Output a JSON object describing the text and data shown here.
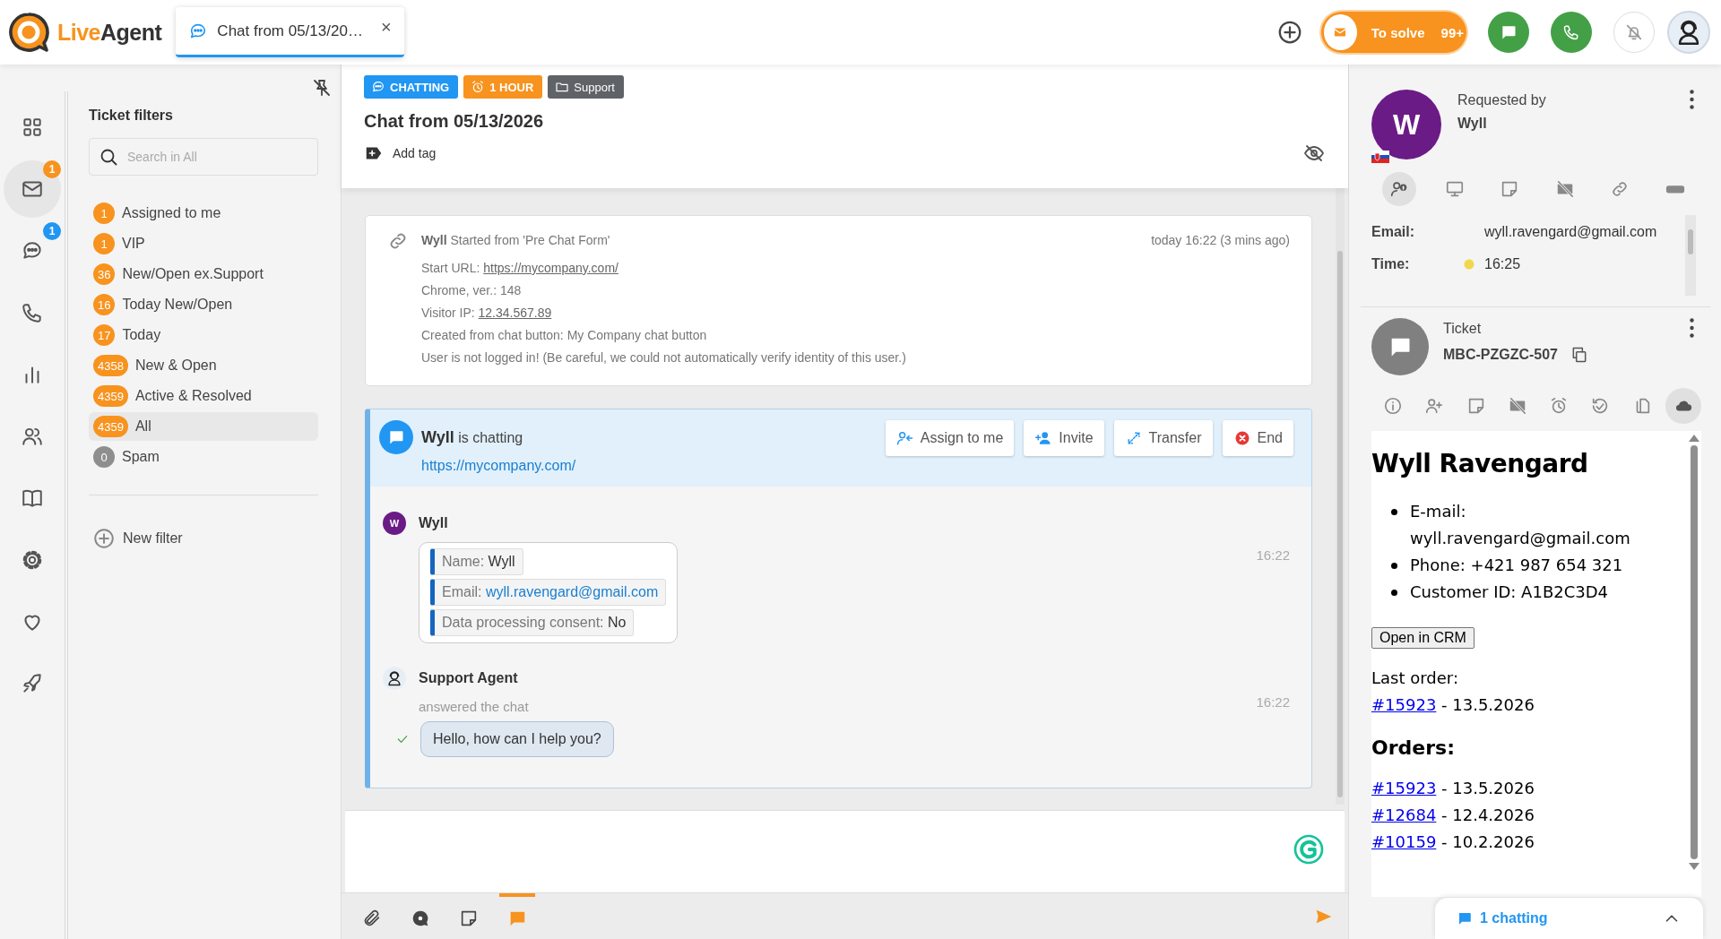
{
  "app": {
    "logo_primary": "Live",
    "logo_secondary": "Agent"
  },
  "top_tabs": [
    {
      "label": "Chat from 05/13/20…",
      "close": "×",
      "selected": true
    }
  ],
  "to_solve": {
    "label": "To solve",
    "count": "99+"
  },
  "nav": [
    {
      "kind": "dashboard",
      "selected": false
    },
    {
      "kind": "tickets",
      "selected": true,
      "badge": {
        "text": "1",
        "color": "#f7931e"
      }
    },
    {
      "kind": "chats",
      "selected": false,
      "badge": {
        "text": "1",
        "color": "#2196f3"
      }
    },
    {
      "kind": "calls",
      "selected": false
    },
    {
      "kind": "reports",
      "selected": false
    },
    {
      "kind": "customers",
      "selected": false
    },
    {
      "kind": "knowledgebase",
      "selected": false
    },
    {
      "kind": "settings",
      "selected": false
    },
    {
      "kind": "plugins",
      "selected": false
    },
    {
      "kind": "getting_started",
      "selected": false
    }
  ],
  "filters": {
    "title": "Ticket filters",
    "search": {
      "placeholder": "Search in All"
    },
    "items": [
      {
        "count": "1",
        "label": "Assigned to me",
        "color": "#f7931e",
        "selected": false
      },
      {
        "count": "1",
        "label": "VIP",
        "color": "#f7931e",
        "selected": false
      },
      {
        "count": "36",
        "label": "New/Open ex.Support",
        "color": "#f7931e",
        "selected": false
      },
      {
        "count": "16",
        "label": "Today New/Open",
        "color": "#f7931e",
        "selected": false
      },
      {
        "count": "17",
        "label": "Today",
        "color": "#f7931e",
        "selected": false
      },
      {
        "count": "4358",
        "label": "New & Open",
        "color": "#f7931e",
        "selected": false
      },
      {
        "count": "4359",
        "label": "Active & Resolved",
        "color": "#f7931e",
        "selected": false
      },
      {
        "count": "4359",
        "label": "All",
        "color": "#f7931e",
        "selected": true
      },
      {
        "count": "0",
        "label": "Spam",
        "color": "#8e8e8e",
        "selected": false
      }
    ],
    "new_filter": "New filter"
  },
  "ticket": {
    "tags": [
      {
        "kind": "status",
        "label": "CHATTING",
        "color": "#2196f3"
      },
      {
        "kind": "sla",
        "label": "1 HOUR",
        "color": "#f7931e"
      },
      {
        "kind": "department",
        "label": "Support",
        "color": "#5f6368"
      }
    ],
    "title": "Chat from 05/13/2026",
    "add_tag": "Add tag"
  },
  "info_card": {
    "name": "Wyll",
    "source": "Started from 'Pre Chat Form'",
    "time": "today 16:22 (3 mins ago)",
    "lines": [
      {
        "text": "Start URL:",
        "link": "https://mycompany.com/"
      },
      {
        "text": "Chrome, ver.: 148"
      },
      {
        "text": "Visitor IP:",
        "link": "12.34.567.89"
      },
      {
        "text": "Created from chat button: My Company chat button"
      },
      {
        "text": "User is not logged in! (Be careful, we could not automatically verify identity of this user.)"
      }
    ]
  },
  "chat": {
    "visitor": "Wyll",
    "status": "is chatting",
    "url": "https://mycompany.com/",
    "actions": [
      {
        "kind": "assign",
        "label": "Assign to me"
      },
      {
        "kind": "invite",
        "label": "Invite"
      },
      {
        "kind": "transfer",
        "label": "Transfer"
      },
      {
        "kind": "end",
        "label": "End"
      }
    ],
    "messages": [
      {
        "kind": "form",
        "author": "Wyll",
        "initial": "W",
        "time": "16:22",
        "fields": [
          {
            "label": "Name:",
            "value": "Wyll",
            "link": false
          },
          {
            "label": "Email:",
            "value": "wyll.ravengard@gmail.com",
            "link": true
          },
          {
            "label": "Data processing consent:",
            "value": "No",
            "link": false
          }
        ]
      },
      {
        "kind": "agent",
        "author": "Support Agent",
        "note": "answered the chat",
        "time": "16:22",
        "text": "Hello, how can I help you?",
        "delivered": true
      }
    ]
  },
  "composer": {
    "tools": [
      {
        "kind": "attach",
        "selected": false
      },
      {
        "kind": "canned",
        "selected": false
      },
      {
        "kind": "note",
        "selected": false
      },
      {
        "kind": "chat",
        "selected": true
      }
    ]
  },
  "contact": {
    "label": "Requested by",
    "name": "Wyll",
    "initial": "W",
    "tabs": [
      {
        "kind": "contact-info",
        "selected": true
      },
      {
        "kind": "devices",
        "selected": false
      },
      {
        "kind": "notes",
        "selected": false
      },
      {
        "kind": "video",
        "selected": false
      },
      {
        "kind": "links",
        "selected": false
      },
      {
        "kind": "woocommerce",
        "selected": false
      }
    ],
    "fields": [
      {
        "kind": "text",
        "label": "Email:",
        "value": "wyll.ravengard@gmail.com"
      },
      {
        "kind": "time",
        "label": "Time:",
        "value": "16:25"
      }
    ]
  },
  "ticket_panel": {
    "label": "Ticket",
    "code": "MBC-PZGZC-507",
    "tabs": [
      {
        "kind": "info",
        "selected": false
      },
      {
        "kind": "add-cc",
        "selected": false
      },
      {
        "kind": "notes",
        "selected": false
      },
      {
        "kind": "video",
        "selected": false
      },
      {
        "kind": "reminder",
        "selected": false
      },
      {
        "kind": "history",
        "selected": false
      },
      {
        "kind": "attachments",
        "selected": false
      },
      {
        "kind": "crm",
        "selected": true
      }
    ]
  },
  "crm": {
    "heading": "Wyll Ravengard",
    "items": [
      "E-mail: wyll.ravengard@gmail.com",
      "Phone: +421 987 654 321",
      "Customer ID: A1B2C3D4"
    ],
    "button": "Open in CRM",
    "last_order_label": "Last order:",
    "last_order": {
      "id": "#15923",
      "date": "- 13.5.2026"
    },
    "orders_heading": "Orders:",
    "orders": [
      {
        "id": "#15923",
        "date": "- 13.5.2026"
      },
      {
        "id": "#12684",
        "date": "- 12.4.2026"
      },
      {
        "id": "#10159",
        "date": "- 10.2.2026"
      }
    ]
  },
  "chatting_bar": {
    "label": "1 chatting"
  }
}
